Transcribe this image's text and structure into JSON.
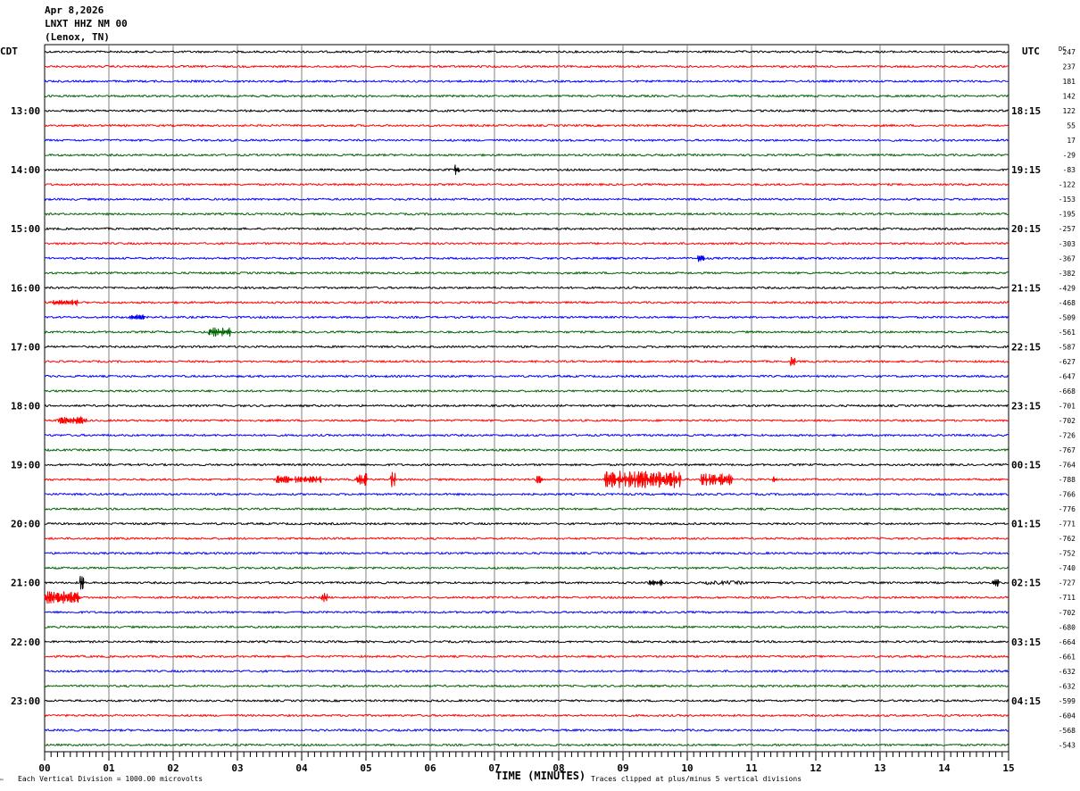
{
  "header": {
    "date": "Apr 8,2026",
    "station": "LNXT HHZ NM 00",
    "location": "(Lenox, TN)"
  },
  "left_tz": "CDT",
  "right_tz": "UTC",
  "dc_header": "DC",
  "footer": {
    "scale": "Each Vertical Division = 1000.00 microvolts",
    "xlabel": "TIME (MINUTES)",
    "clip": "Traces clipped at plus/minus 5 vertical divisions",
    "corner": "™"
  },
  "colors": {
    "trace_cycle": [
      "#000000",
      "#ff0000",
      "#0000ff",
      "#006400"
    ],
    "grid": "#808080"
  },
  "chart_data": {
    "type": "line",
    "subtype": "helicorder",
    "title": "LNXT HHZ NM 00",
    "xlabel": "TIME (MINUTES)",
    "xlim": [
      0,
      15
    ],
    "x_ticks": [
      "00",
      "01",
      "02",
      "03",
      "04",
      "05",
      "06",
      "07",
      "08",
      "09",
      "10",
      "11",
      "12",
      "13",
      "14",
      "15"
    ],
    "trace_count": 48,
    "trace_minutes": 15,
    "left_hour_labels": [
      {
        "trace": 4,
        "text": "13:00"
      },
      {
        "trace": 8,
        "text": "14:00"
      },
      {
        "trace": 12,
        "text": "15:00"
      },
      {
        "trace": 16,
        "text": "16:00"
      },
      {
        "trace": 20,
        "text": "17:00"
      },
      {
        "trace": 24,
        "text": "18:00"
      },
      {
        "trace": 28,
        "text": "19:00"
      },
      {
        "trace": 32,
        "text": "20:00"
      },
      {
        "trace": 36,
        "text": "21:00"
      },
      {
        "trace": 40,
        "text": "22:00"
      },
      {
        "trace": 44,
        "text": "23:00"
      }
    ],
    "right_hour_labels": [
      {
        "trace": 4,
        "text": "18:15"
      },
      {
        "trace": 8,
        "text": "19:15"
      },
      {
        "trace": 12,
        "text": "20:15"
      },
      {
        "trace": 16,
        "text": "21:15"
      },
      {
        "trace": 20,
        "text": "22:15"
      },
      {
        "trace": 24,
        "text": "23:15"
      },
      {
        "trace": 28,
        "text": "00:15"
      },
      {
        "trace": 32,
        "text": "01:15"
      },
      {
        "trace": 36,
        "text": "02:15"
      },
      {
        "trace": 40,
        "text": "03:15"
      },
      {
        "trace": 44,
        "text": "04:15"
      }
    ],
    "dc_offsets": [
      247,
      237,
      181,
      142,
      122,
      55,
      17,
      -29,
      -83,
      -122,
      -153,
      -195,
      -257,
      -303,
      -367,
      -382,
      -429,
      -468,
      -509,
      -561,
      -587,
      -627,
      -647,
      -668,
      -701,
      -702,
      -726,
      -767,
      -764,
      -788,
      -766,
      -776,
      -771,
      -762,
      -752,
      -740,
      -727,
      -711,
      -702,
      -680,
      -664,
      -661,
      -632,
      -632,
      -599,
      -604,
      -568,
      -543
    ],
    "events": [
      {
        "trace": 8,
        "start": 6.38,
        "end": 6.45,
        "amp": 6
      },
      {
        "trace": 14,
        "start": 10.15,
        "end": 10.25,
        "amp": 4
      },
      {
        "trace": 17,
        "start": 0.1,
        "end": 0.5,
        "amp": 3
      },
      {
        "trace": 18,
        "start": 1.3,
        "end": 1.55,
        "amp": 2.5
      },
      {
        "trace": 19,
        "start": 2.55,
        "end": 2.9,
        "amp": 5
      },
      {
        "trace": 21,
        "start": 11.6,
        "end": 11.68,
        "amp": 5
      },
      {
        "trace": 25,
        "start": 0.2,
        "end": 0.65,
        "amp": 4
      },
      {
        "trace": 29,
        "start": 3.6,
        "end": 4.3,
        "amp": 4
      },
      {
        "trace": 29,
        "start": 4.85,
        "end": 5.0,
        "amp": 7
      },
      {
        "trace": 29,
        "start": 5.38,
        "end": 5.45,
        "amp": 9
      },
      {
        "trace": 29,
        "start": 7.65,
        "end": 7.75,
        "amp": 4
      },
      {
        "trace": 29,
        "start": 8.7,
        "end": 9.9,
        "amp": 10
      },
      {
        "trace": 29,
        "start": 10.2,
        "end": 10.7,
        "amp": 7
      },
      {
        "trace": 29,
        "start": 11.3,
        "end": 11.4,
        "amp": 3
      },
      {
        "trace": 36,
        "start": 0.55,
        "end": 0.6,
        "amp": 8
      },
      {
        "trace": 36,
        "start": 9.4,
        "end": 9.6,
        "amp": 3
      },
      {
        "trace": 36,
        "start": 10.3,
        "end": 10.9,
        "amp": 2
      },
      {
        "trace": 36,
        "start": 14.75,
        "end": 14.85,
        "amp": 4
      },
      {
        "trace": 37,
        "start": 0.0,
        "end": 0.55,
        "amp": 7
      },
      {
        "trace": 37,
        "start": 4.3,
        "end": 4.4,
        "amp": 5
      }
    ]
  }
}
